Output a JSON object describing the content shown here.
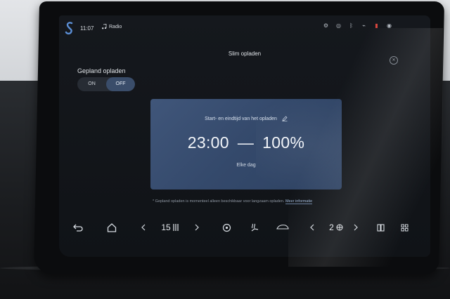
{
  "status_bar": {
    "time": "11:07",
    "media_label": "Radio",
    "icons": [
      "settings-icon",
      "target-icon",
      "bluetooth-icon",
      "wifi-icon",
      "phone-icon",
      "user-icon"
    ]
  },
  "page": {
    "title": "Slim opladen"
  },
  "scheduled_charging": {
    "label": "Gepland opladen",
    "toggle": {
      "on_label": "ON",
      "off_label": "OFF",
      "selected": "OFF"
    }
  },
  "schedule_card": {
    "header": "Start- en eindtijd van het opladen",
    "time": "23:00",
    "separator": "—",
    "target": "100%",
    "repeat": "Elke dag"
  },
  "footnote": {
    "text": "* Gepland opladen is momenteel alleen beschikbaar voor langzaam opladen.",
    "link": "Meer informatie"
  },
  "bottom_bar": {
    "temperature": "15",
    "fan_level": "2",
    "colors": {
      "accent": "#3a4d6a",
      "card": "#3a4f72",
      "status_red": "#d9473f"
    }
  }
}
